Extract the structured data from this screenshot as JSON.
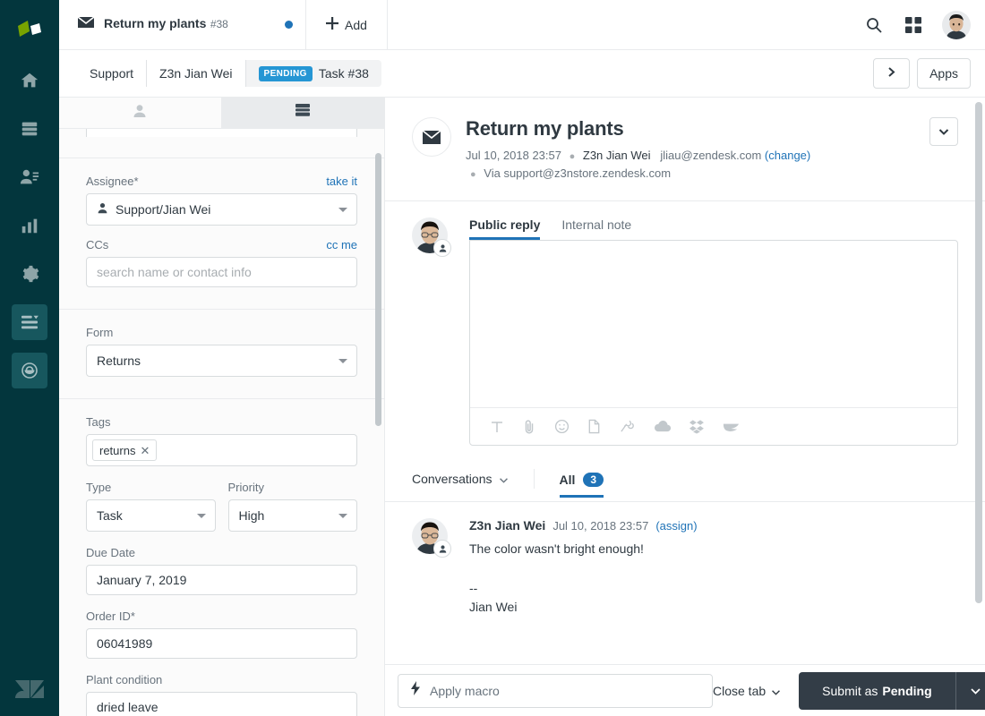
{
  "colors": {
    "rail_bg": "#03363d",
    "rail_active": "#17575e",
    "accent_blue": "#1f73b7",
    "pending_badge": "#2596d4",
    "submit_dark": "#333d47",
    "text_primary": "#2f3941",
    "text_muted": "#68737d",
    "border": "#d8dcde"
  },
  "rail": {
    "logo": "zendesk-products-logo",
    "items": [
      {
        "name": "home",
        "icon": "home-icon",
        "active": false
      },
      {
        "name": "views",
        "icon": "views-icon",
        "active": false
      },
      {
        "name": "customers",
        "icon": "customers-icon",
        "active": false
      },
      {
        "name": "reporting",
        "icon": "bar-chart-icon",
        "active": false
      },
      {
        "name": "admin",
        "icon": "gear-icon",
        "active": false
      },
      {
        "name": "ticket-views-panel",
        "icon": "list-lines-icon",
        "active": true
      },
      {
        "name": "apps-tray",
        "icon": "hat-icon",
        "active": true
      }
    ],
    "footer_logo": "zendesk-z-logo"
  },
  "topbar": {
    "ticket_tab": {
      "icon": "envelope-icon",
      "title": "Return my plants",
      "subtitle": "#38",
      "has_unsaved_dot": true
    },
    "add_label": "Add",
    "add_icon": "plus-icon",
    "search_icon": "search-icon",
    "apps_grid_icon": "grid-apps-icon",
    "avatar": "user-avatar"
  },
  "breadcrumb": {
    "items": [
      {
        "label": "Support",
        "badge": null
      },
      {
        "label": "Z3n Jian Wei",
        "badge": null
      },
      {
        "label": "Task #38",
        "badge": "PENDING"
      }
    ],
    "expand_icon": "chevron-right-icon",
    "apps_label": "Apps"
  },
  "properties": {
    "tabs": [
      {
        "name": "user-tab",
        "icon": "person-icon",
        "active": false
      },
      {
        "name": "ticket-tab",
        "icon": "ticket-icon",
        "active": true
      }
    ],
    "assignee": {
      "label": "Assignee*",
      "action_label": "take it",
      "value": "Support/Jian Wei",
      "icon": "agent-icon"
    },
    "ccs": {
      "label": "CCs",
      "action_label": "cc me",
      "value": "",
      "placeholder": "search name or contact info"
    },
    "form": {
      "label": "Form",
      "value": "Returns"
    },
    "tags": {
      "label": "Tags",
      "values": [
        "returns"
      ],
      "remove_icon": "close-icon"
    },
    "type": {
      "label": "Type",
      "value": "Task"
    },
    "priority": {
      "label": "Priority",
      "value": "High"
    },
    "due_date": {
      "label": "Due Date",
      "value": "January 7, 2019"
    },
    "order_id": {
      "label": "Order ID*",
      "value": "06041989"
    },
    "plant_condition": {
      "label": "Plant condition",
      "value": "dried leave"
    }
  },
  "ticket": {
    "icon": "envelope-icon",
    "subject": "Return my plants",
    "meta": {
      "date": "Jul 10, 2018 23:57",
      "requester": "Z3n Jian Wei",
      "email": "jliau@zendesk.com",
      "change_label": "(change)",
      "via": "Via support@z3nstore.zendesk.com"
    },
    "options_icon": "chevron-down-icon"
  },
  "composer": {
    "tabs": [
      {
        "label": "Public reply",
        "active": true
      },
      {
        "label": "Internal note",
        "active": false
      }
    ],
    "body": "",
    "avatar_badge_icon": "end-user-icon",
    "toolbar": [
      {
        "name": "text-format-icon",
        "glyph": "T"
      },
      {
        "name": "attachment-icon",
        "glyph": "paperclip"
      },
      {
        "name": "emoji-icon",
        "glyph": "smiley"
      },
      {
        "name": "article-icon",
        "glyph": "file"
      },
      {
        "name": "link-pin-icon",
        "glyph": "pin"
      },
      {
        "name": "google-drive-icon",
        "glyph": "cloud"
      },
      {
        "name": "dropbox-icon",
        "glyph": "dropbox"
      },
      {
        "name": "box-icon",
        "glyph": "wave"
      }
    ]
  },
  "conversation": {
    "filter_label": "Conversations",
    "filter_icon": "chevron-down-icon",
    "all_label": "All",
    "all_count": "3",
    "comments": [
      {
        "author": "Z3n Jian Wei",
        "date": "Jul 10, 2018 23:57",
        "action_label": "(assign)",
        "text": "The color wasn't bright enough!\n\n--\nJian Wei",
        "avatar_badge_icon": "end-user-icon"
      }
    ]
  },
  "footer": {
    "macro_icon": "lightning-icon",
    "macro_placeholder": "Apply macro",
    "close_tab_label": "Close tab",
    "close_tab_icon": "chevron-down-icon",
    "submit_prefix": "Submit as ",
    "submit_status": "Pending",
    "submit_caret_icon": "chevron-down-icon"
  }
}
